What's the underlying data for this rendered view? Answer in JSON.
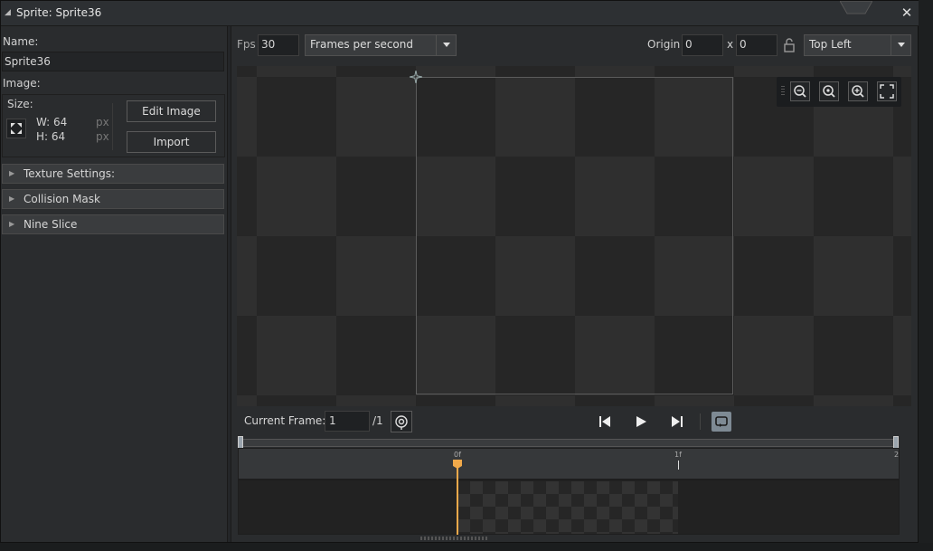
{
  "window": {
    "title": "Sprite: Sprite36",
    "close_icon": "close-icon"
  },
  "left_panel": {
    "name_label": "Name:",
    "name_value": "Sprite36",
    "image_label": "Image:",
    "size_label": "Size:",
    "width_text": "W: 64",
    "height_text": "H: 64",
    "unit_w": "px",
    "unit_h": "px",
    "edit_image_button": "Edit Image",
    "import_button": "Import",
    "sections": [
      {
        "label": "Texture Settings:"
      },
      {
        "label": "Collision Mask"
      },
      {
        "label": "Nine Slice"
      }
    ]
  },
  "toolbar": {
    "fps_label": "Fps",
    "fps_value": "30",
    "speed_mode": "Frames per second",
    "origin_label": "Origin",
    "origin_x": "0",
    "origin_sep": "x",
    "origin_y": "0",
    "origin_preset": "Top Left"
  },
  "zoom_controls": [
    "zoom-out-icon",
    "zoom-reset-icon",
    "zoom-in-icon",
    "fit-to-screen-icon"
  ],
  "playback": {
    "current_frame_label": "Current Frame:",
    "current_frame_value": "1",
    "total_frames": "/1"
  },
  "timeline": {
    "ticks": [
      "0f",
      "1f",
      "2"
    ]
  },
  "colors": {
    "playhead": "#f0a94a",
    "panel_bg": "#2a2c2e",
    "canvas_dark": "#262626",
    "canvas_light": "#2f2f2f"
  }
}
